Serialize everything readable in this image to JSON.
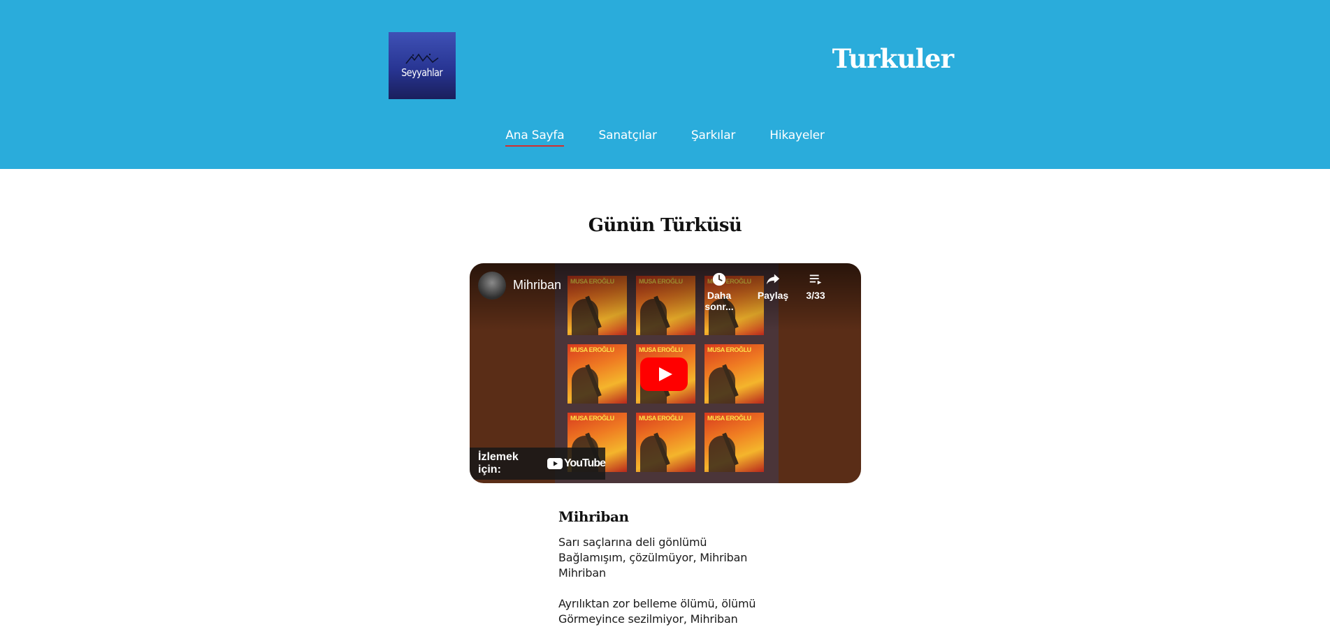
{
  "header": {
    "logo_text": "Seyyahlar",
    "site_title": "Turkuler",
    "nav": [
      {
        "label": "Ana Sayfa",
        "active": true
      },
      {
        "label": "Sanatçılar",
        "active": false
      },
      {
        "label": "Şarkılar",
        "active": false
      },
      {
        "label": "Hikayeler",
        "active": false
      }
    ]
  },
  "main": {
    "section_title": "Günün Türküsü",
    "video": {
      "title": "Mihriban",
      "album_label": "MUSA EROĞLU",
      "watch_later_label": "Daha sonr...",
      "share_label": "Paylaş",
      "playlist_position": "3/33",
      "watch_on_label": "İzlemek için:",
      "youtube_wordmark": "YouTube"
    },
    "song": {
      "title": "Mihriban",
      "stanzas": [
        {
          "lines": [
            "Sarı saçlarına deli gönlümü",
            "Bağlamışım, çözülmüyor, Mihriban",
            "Mihriban"
          ]
        },
        {
          "lines": [
            "Ayrılıktan zor belleme ölümü, ölümü",
            "Görmeyince sezilmiyor, Mihriban"
          ]
        }
      ]
    }
  },
  "colors": {
    "header_bg": "#2aacdb",
    "active_underline": "#d32f2f",
    "youtube_red": "#ff0000"
  },
  "icons": [
    "clock-icon",
    "share-icon",
    "playlist-icon",
    "play-icon",
    "youtube-logo-icon"
  ]
}
